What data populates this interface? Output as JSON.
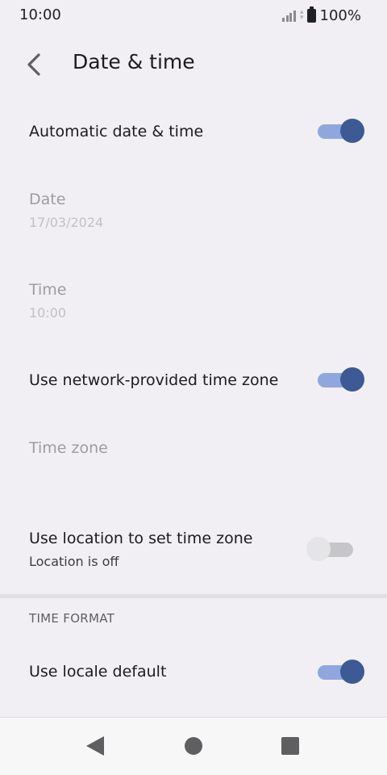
{
  "status_bar": {
    "time": "10:00",
    "battery_text": "100%",
    "icons": [
      "signal-icon",
      "data-arrows-icon",
      "battery-icon"
    ]
  },
  "header": {
    "title": "Date & time",
    "back_icon": "back-arrow-icon"
  },
  "settings": {
    "automatic_date_time": {
      "title": "Automatic date & time",
      "enabled": true
    },
    "date": {
      "title": "Date",
      "summary": "17/03/2024",
      "disabled": true
    },
    "time": {
      "title": "Time",
      "summary": "10:00",
      "disabled": true
    },
    "network_time_zone": {
      "title": "Use network-provided time zone",
      "enabled": true
    },
    "time_zone": {
      "title": "Time zone",
      "disabled": true
    },
    "location_time_zone": {
      "title": "Use location to set time zone",
      "summary": "Location is off",
      "enabled": false
    }
  },
  "time_format": {
    "header": "TIME FORMAT",
    "use_locale_default": {
      "title": "Use locale default",
      "enabled": true
    }
  },
  "nav_bar": {
    "icons": [
      "nav-back-icon",
      "nav-home-icon",
      "nav-recents-icon"
    ]
  },
  "colors": {
    "background": "#f1eff3",
    "toggle_on_track": "#8fa7dd",
    "toggle_on_thumb": "#3d5a94",
    "toggle_off_track": "#c6c6c8",
    "toggle_off_thumb": "#e5e4e6",
    "disabled_text": "#9e9ca2"
  }
}
